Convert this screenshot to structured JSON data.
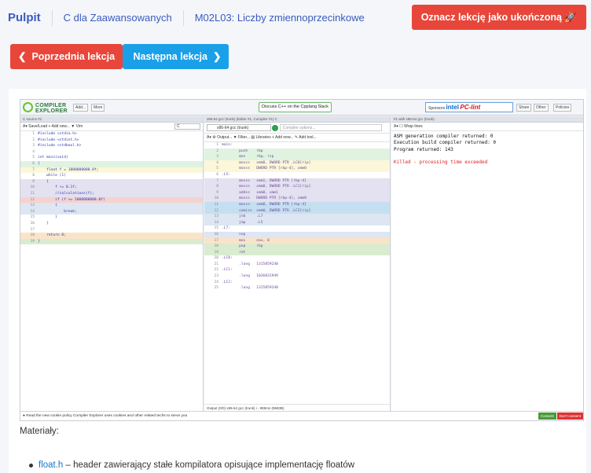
{
  "breadcrumb": {
    "home": "Pulpit",
    "course": "C dla Zaawansowanych",
    "lesson": "M02L03: Liczby zmiennoprzecinkowe"
  },
  "buttons": {
    "mark_done": "Oznacz lekcję jako ukończoną",
    "prev": "Poprzednia lekcja",
    "next": "Następna lekcja"
  },
  "embed": {
    "logo_top": "COMPILER",
    "logo_bottom": "EXPLORER",
    "header_buttons": [
      "Add...",
      "More"
    ],
    "discuss": "Discuss C++ on the Cpplang Slack",
    "sponsor": "Sponsors",
    "sponsor_brand1": "intel",
    "sponsor_brand2": "PC-lint",
    "right_buttons": [
      "Share",
      "Other",
      "Policies"
    ],
    "editor": {
      "tab": "C source #1",
      "toolbar": "A▾  Save/Load  + Add new...  ▼ Vim",
      "lang": "C",
      "lines": [
        "#include <stdio.h>",
        "#include <stdint.h>",
        "#include <stdbool.h>",
        "",
        "int main(void)",
        "{",
        "    float f = 1000000000.0f;",
        "    while (1)",
        "    {",
        "        f += 0.1f;",
        "        //calculations(f);",
        "        if (f >= 1000000000.0f)",
        "        {",
        "            break;",
        "        }",
        "    }",
        "",
        "    return 0;",
        "}"
      ]
    },
    "compiler": {
      "tab": "x86-64 gcc (trunk) (Editor #1, Compiler #1) C",
      "name": "x86-64 gcc (trunk)",
      "options_placeholder": "Compiler options...",
      "toolbar": "A▾  ⚙ Output...  ▼ Filter...  ▤ Libraries  + Add new...  ✎ Add tool...",
      "asm": [
        "main:",
        "        push    rbp",
        "        mov     rbp, rsp",
        "        movss   xmm0, DWORD PTR .LC0[rip]",
        "        movss   DWORD PTR [rbp-4], xmm0",
        ".L5:",
        "        movss   xmm1, DWORD PTR [rbp-4]",
        "        movss   xmm0, DWORD PTR .LC1[rip]",
        "        addss   xmm0, xmm1",
        "        movss   DWORD PTR [rbp-4], xmm0",
        "        movss   xmm0, DWORD PTR [rbp-4]",
        "        comiss  xmm0, DWORD PTR .LC2[rip]",
        "        jnb     .L7",
        "        jmp     .L5",
        ".L7:",
        "        nop",
        "        mov     eax, 0",
        "        pop     rbp",
        "        ret",
        ".LC0:",
        "        .long   1315859240",
        ".LC1:",
        "        .long   1036831949",
        ".LC2:",
        "        .long   1315859240"
      ],
      "footer": "Output (0/0)  x86-64 gcc (trunk)  i  - 985ms (9683B)"
    },
    "output": {
      "tab": "#1 with x86-64 gcc (trunk)",
      "toolbar": "A▾  ☐ Wrap lines",
      "lines": [
        "ASM generation compiler returned: 0",
        "Execution build compiler returned: 0",
        "Program returned: 143"
      ],
      "killed": "Killed - processing time exceeded"
    },
    "cookie": "● Read the new cookie policy   Compiler Explorer uses cookies and other related techs to serve you",
    "consent": "Consent",
    "no_consent": "Don't consent"
  },
  "materials": {
    "heading": "Materiały:",
    "link": "float.h",
    "desc": " – header zawierający stałe kompilatora opisujące implementację floatów"
  },
  "colors": {
    "red": "#e8463a",
    "blue": "#1aa0e8",
    "link": "#3b5bbf"
  }
}
